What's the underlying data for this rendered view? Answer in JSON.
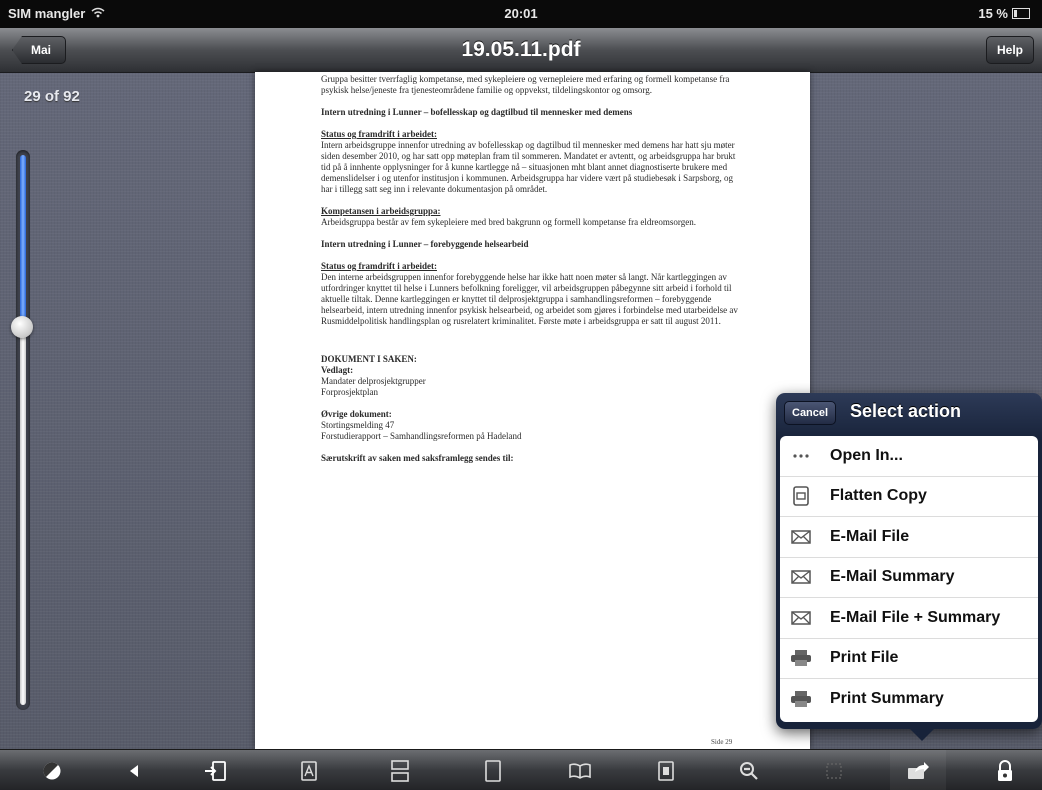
{
  "status_bar": {
    "carrier": "SIM mangler",
    "time": "20:01",
    "battery": "15 %"
  },
  "nav": {
    "back_label": "Mai",
    "title": "19.05.11.pdf",
    "help_label": "Help"
  },
  "page_indicator": "29 of 92",
  "zoom_slider": {
    "value_fraction": 0.68
  },
  "document": {
    "blocks": [
      {
        "style": "normal",
        "text": "Gruppa besitter tverrfaglig kompetanse, med sykepleiere og vernepleiere med erfaring og formell kompetanse fra psykisk helse/jeneste fra tjenesteområdene familie og oppvekst, tildelingskontor og omsorg."
      },
      {
        "style": "bold",
        "text": "Intern utredning i Lunner – bofellesskap og dagtilbud til mennesker med demens"
      },
      {
        "style": "heading-underline",
        "text": "Status og framdrift i arbeidet:"
      },
      {
        "style": "normal",
        "text": "Intern arbeidsgruppe innenfor utredning av bofellesskap og dagtilbud til mennesker med demens har hatt sju møter siden desember 2010, og har satt opp møteplan fram til sommeren. Mandatet er avtentt, og arbeidsgruppa har brukt tid på å innhente opplysninger for å kunne kartlegge nå – situasjonen mht blant annet diagnostiserte brukere med demenslidelser i og utenfor institusjon i kommunen. Arbeidsgruppa har videre vært på studiebesøk i Sarpsborg, og har i tillegg satt seg inn i relevante dokumentasjon på området."
      },
      {
        "style": "heading-underline",
        "text": "Kompetansen i arbeidsgruppa:"
      },
      {
        "style": "normal",
        "text": "Arbeidsgruppa består av fem sykepleiere med bred bakgrunn og formell kompetanse fra eldreomsorgen."
      },
      {
        "style": "bold",
        "text": "Intern utredning i Lunner – forebyggende helsearbeid"
      },
      {
        "style": "heading-underline",
        "text": "Status og framdrift i arbeidet:"
      },
      {
        "style": "normal",
        "text": "Den interne arbeidsgruppen innenfor forebyggende helse har ikke hatt noen møter så langt. Når kartleggingen av utfordringer knyttet til helse i Lunners befolkning foreligger, vil arbeidsgruppen påbegynne sitt arbeid i forhold til aktuelle tiltak. Denne kartleggingen er knyttet til delprosjektgruppa i samhandlingsreformen – forebyggende helsearbeid, intern utredning innenfor psykisk helsearbeid, og arbeidet som gjøres i forbindelse med utarbeidelse av Rusmiddelpolitisk handlingsplan og rusrelatert kriminalitet. Første møte i arbeidsgruppa er satt til august 2011."
      }
    ],
    "case_docs": {
      "heading": "DOKUMENT I SAKEN:",
      "attached_label": "Vedlagt:",
      "attached": [
        "Mandater delprosjektgrupper",
        "Forprosjektplan"
      ],
      "other_label": "Øvrige dokument:",
      "other": [
        "Stortingsmelding 47",
        "Forstudierapport – Samhandlingsreformen på Hadeland"
      ],
      "copy_to": "Særutskrift av saken med saksframlegg sendes til:"
    },
    "footer": "Side 29"
  },
  "action_popover": {
    "cancel_label": "Cancel",
    "title": "Select action",
    "items": [
      {
        "label": "Open In...",
        "icon": "ellipsis-icon"
      },
      {
        "label": "Flatten Copy",
        "icon": "document-copy-icon"
      },
      {
        "label": "E-Mail File",
        "icon": "envelope-icon"
      },
      {
        "label": "E-Mail Summary",
        "icon": "envelope-icon"
      },
      {
        "label": "E-Mail File + Summary",
        "icon": "envelope-icon"
      },
      {
        "label": "Print File",
        "icon": "printer-icon"
      },
      {
        "label": "Print Summary",
        "icon": "printer-icon"
      }
    ]
  },
  "toolbar": {
    "buttons": [
      "brightness-icon",
      "back-arrow-icon",
      "import-icon",
      "annotate-icon",
      "double-page-icon",
      "single-page-icon",
      "book-icon",
      "page-info-icon",
      "zoom-out-icon",
      "crop-icon",
      "share-icon",
      "lock-rotation-icon"
    ],
    "selected": "share-icon"
  }
}
